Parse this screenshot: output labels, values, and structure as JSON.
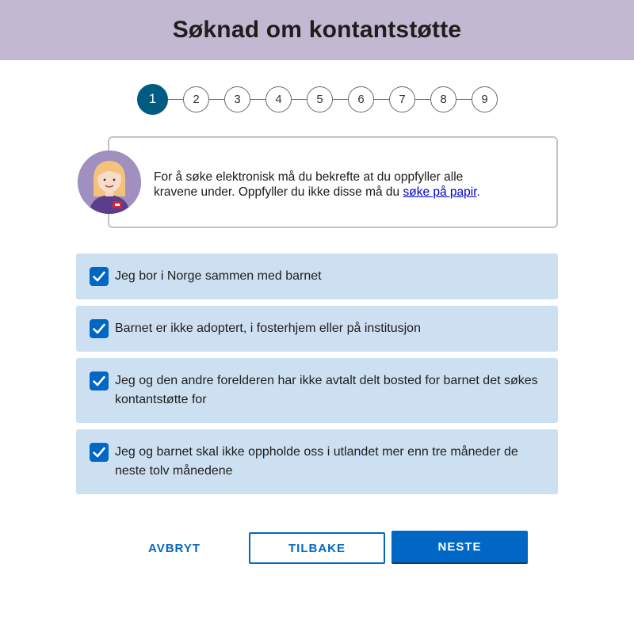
{
  "header": {
    "title": "Søknad om kontantstøtte"
  },
  "stepper": {
    "steps": [
      "1",
      "2",
      "3",
      "4",
      "5",
      "6",
      "7",
      "8",
      "9"
    ],
    "current": 1
  },
  "info": {
    "text_before": "For å søke elektronisk må du bekrefte at du oppfyller alle kravene under. Oppfyller du ikke disse må du ",
    "link_text": "søke på papir",
    "text_after": "."
  },
  "requirements": [
    {
      "label": "Jeg bor i Norge sammen med barnet",
      "checked": true
    },
    {
      "label": "Barnet er ikke adoptert, i fosterhjem eller på institusjon",
      "checked": true
    },
    {
      "label": "Jeg og den andre forelderen har ikke avtalt delt bosted for barnet det søkes kontantstøtte for",
      "checked": true
    },
    {
      "label": "Jeg og barnet skal ikke oppholde oss i utlandet mer enn tre måneder de neste tolv månedene",
      "checked": true
    }
  ],
  "buttons": {
    "cancel": "AVBRYT",
    "back": "TILBAKE",
    "next": "NESTE"
  },
  "colors": {
    "header_bg": "#c3b8d2",
    "accent": "#0067c5",
    "step_active": "#005b82",
    "checkbox_row_bg": "#cce0f2"
  },
  "icons": {
    "check": "checkmark-icon",
    "avatar": "veileder-avatar-icon"
  }
}
